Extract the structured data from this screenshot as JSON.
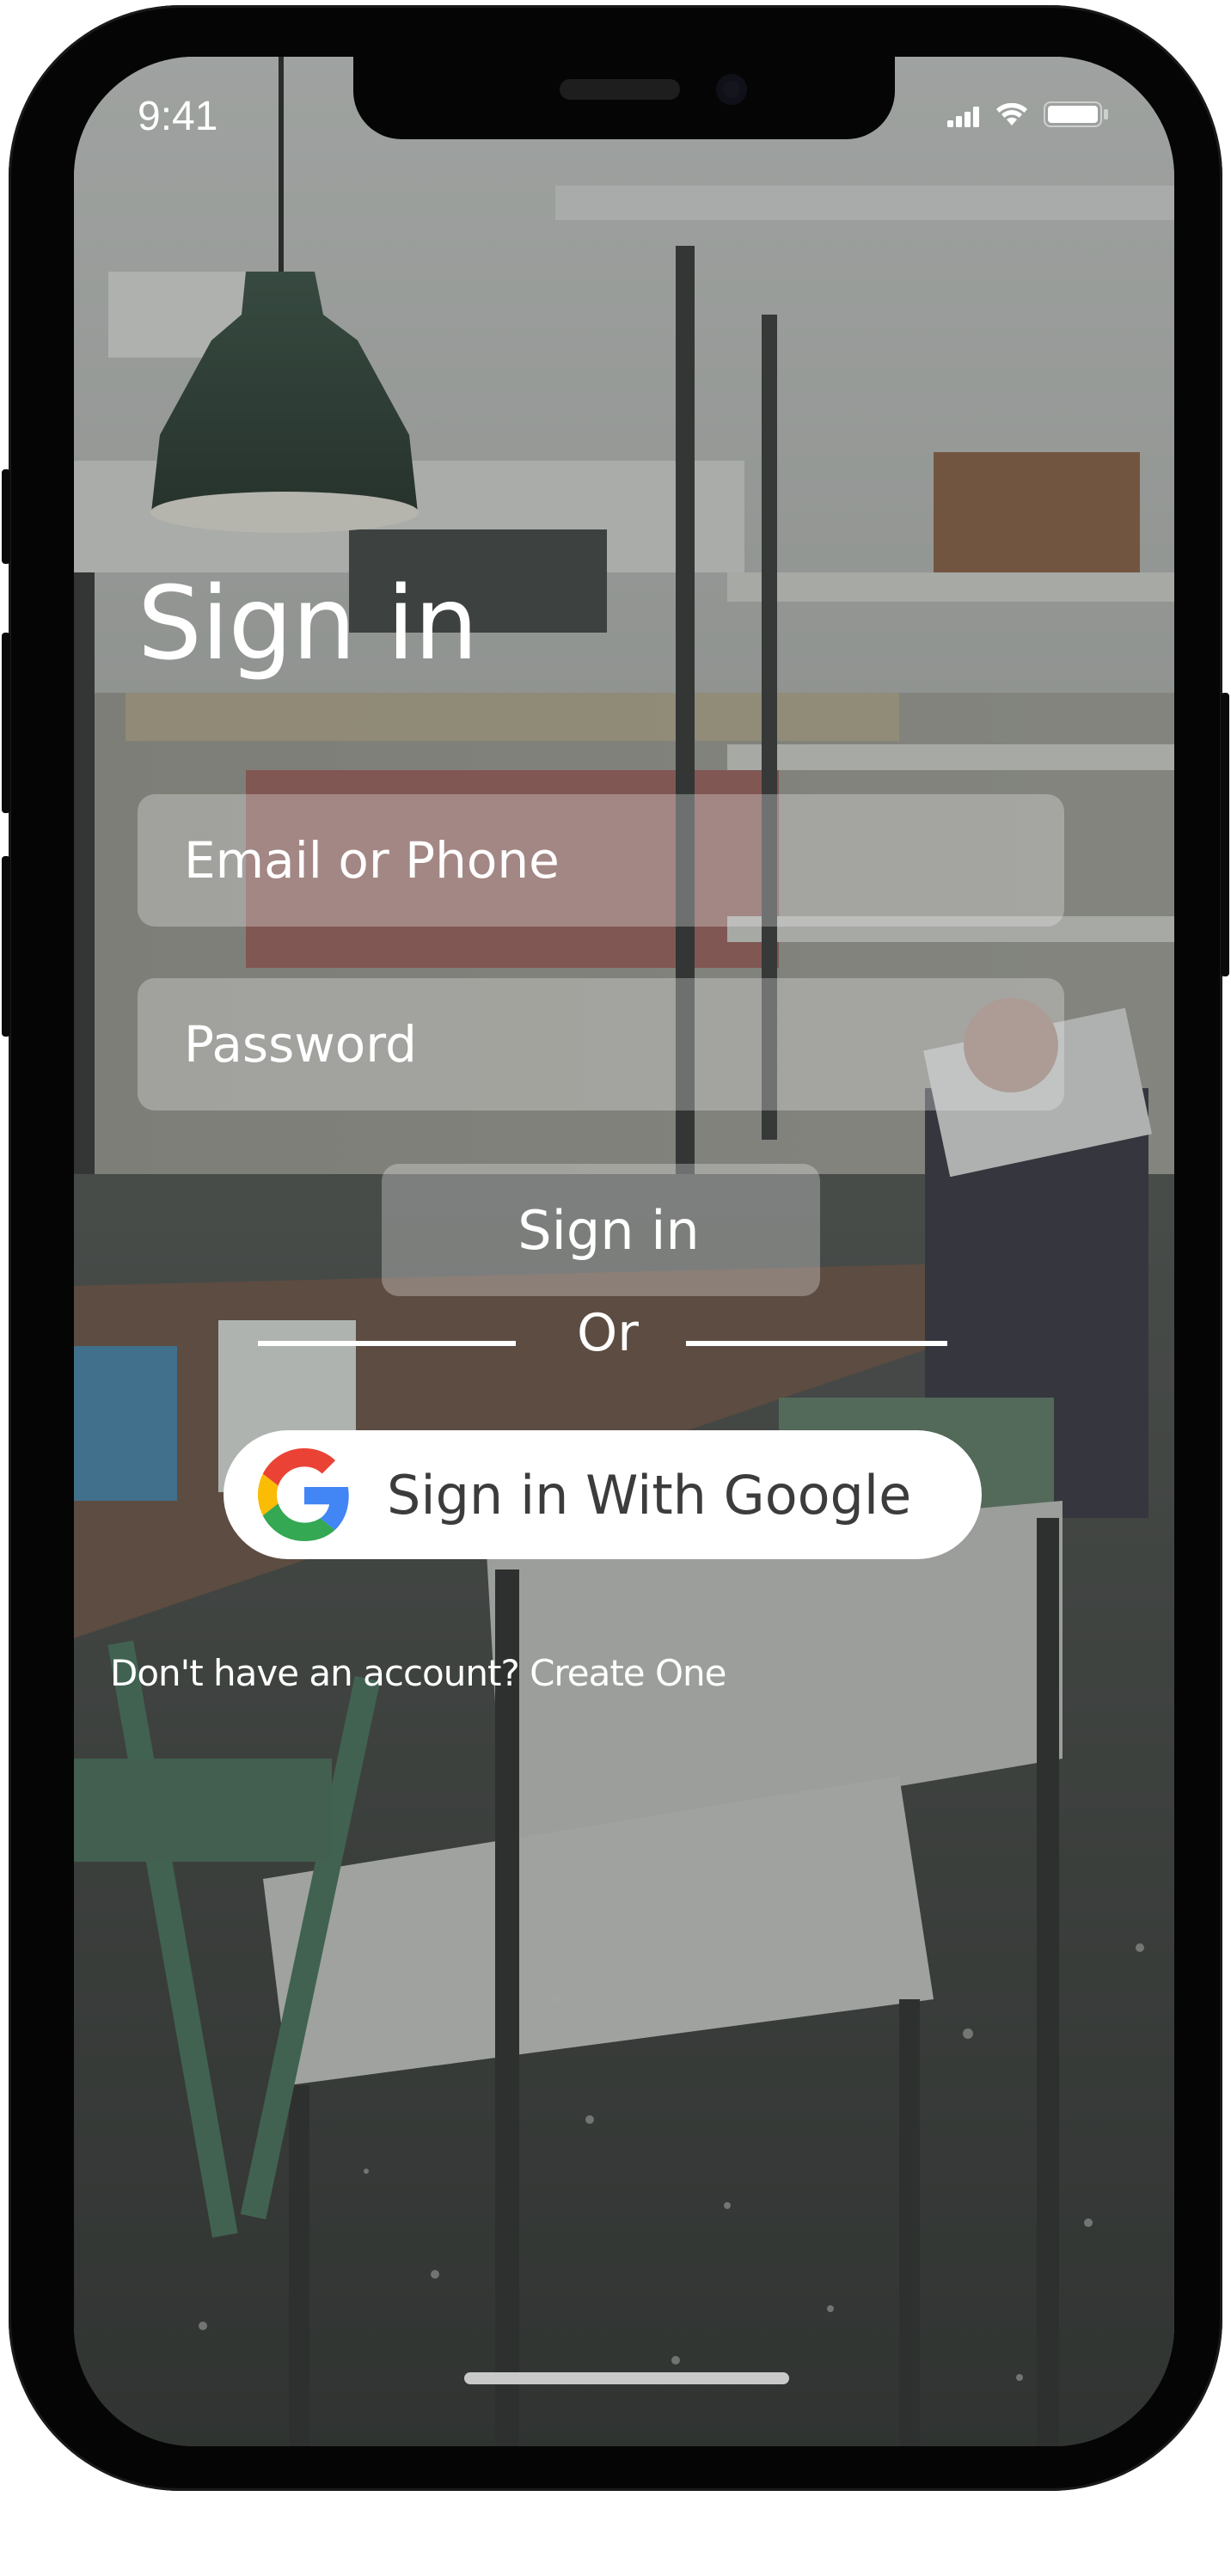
{
  "status_bar": {
    "time": "9:41",
    "icons": [
      "signal-icon",
      "wifi-icon",
      "battery-icon"
    ]
  },
  "login": {
    "title": "Sign in",
    "email_placeholder": "Email or Phone",
    "password_placeholder": "Password",
    "signin_label": "Sign in",
    "divider_text": "Or",
    "google_label": "Sign in With Google",
    "account_prompt": "Don't have an account? Create One"
  },
  "colors": {
    "text": "#ffffff",
    "google_blue": "#4285F4",
    "google_red": "#EA4335",
    "google_yellow": "#FBBC05",
    "google_green": "#34A853",
    "field_fill": "rgba(235,235,235,0.32)"
  }
}
